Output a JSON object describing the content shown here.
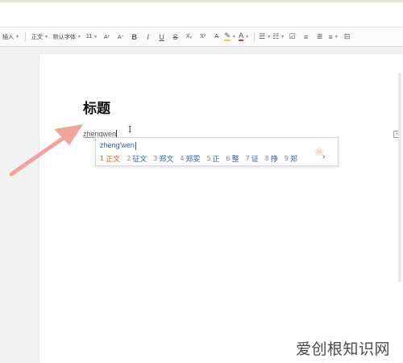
{
  "toolbar": {
    "insert": "插入",
    "style": "正文",
    "font": "默认字体",
    "size": "11",
    "icons": {
      "grow": "Aᐩ",
      "shrink": "Aᐨ",
      "bold": "B",
      "italic": "I",
      "underline": "U",
      "strike": "S",
      "sub": "X₂",
      "sup": "X²",
      "clear": "A̶",
      "highlight": "✎",
      "fontcolor": "A",
      "bullets": "☰",
      "numbering": "☷",
      "checkbox": "☑",
      "align_left": "≡",
      "align_center": "≣",
      "more": "≡",
      "indent": "⊟"
    },
    "highlight_color": "#f5d33f",
    "font_color": "#e03b2a"
  },
  "document": {
    "heading": "标题",
    "typed_text": "zhengwen"
  },
  "ime": {
    "pinyin": "zheng'wen",
    "candidates": [
      {
        "num": "1",
        "text": "正文"
      },
      {
        "num": "2",
        "text": "征文"
      },
      {
        "num": "3",
        "text": "郑文"
      },
      {
        "num": "4",
        "text": "郑雯"
      },
      {
        "num": "5",
        "text": "正"
      },
      {
        "num": "6",
        "text": "整"
      },
      {
        "num": "7",
        "text": "证"
      },
      {
        "num": "8",
        "text": "挣"
      },
      {
        "num": "9",
        "text": "郑"
      }
    ],
    "next": "›",
    "accent_color": "#2d63b8",
    "first_color": "#e05a1c"
  },
  "annotation": {
    "arrow_color": "#f0a49a"
  },
  "watermark": "爱创根知识网"
}
